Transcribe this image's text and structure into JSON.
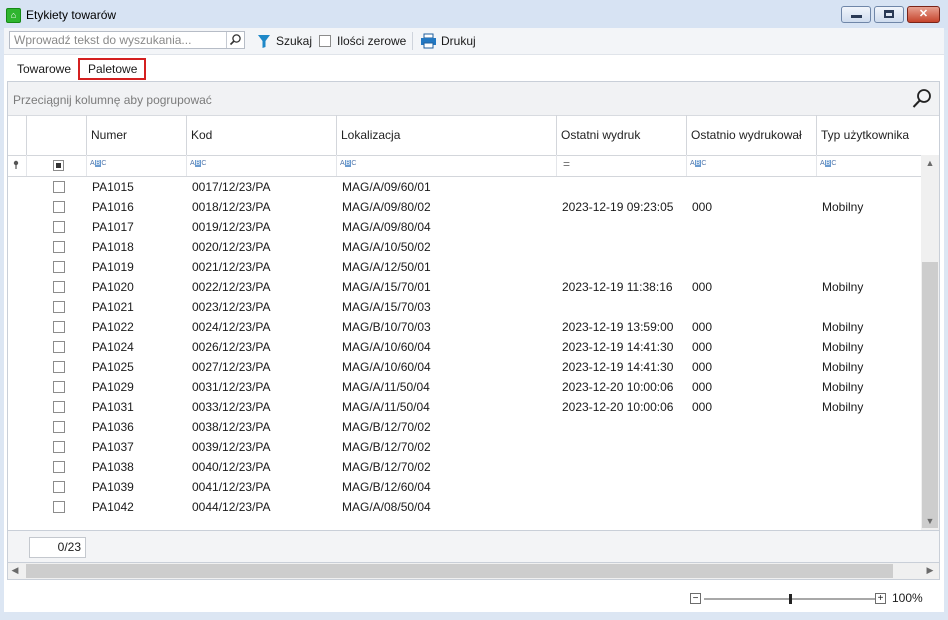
{
  "window": {
    "title": "Etykiety towarów",
    "close_symbol": "✕"
  },
  "toolbar": {
    "search_placeholder": "Wprowadź tekst do wyszukania...",
    "search_button": "Szukaj",
    "zero_qty_label": "Ilości zerowe",
    "print_label": "Drukuj"
  },
  "tabs": [
    {
      "label": "Towarowe"
    },
    {
      "label": "Paletowe"
    }
  ],
  "grid": {
    "group_hint": "Przeciągnij kolumnę aby pogrupować",
    "columns": [
      "Numer",
      "Kod",
      "Lokalizacja",
      "Ostatni wydruk",
      "Ostatnio wydrukował",
      "Typ użytkownika"
    ],
    "rows": [
      [
        "PA1015",
        "0017/12/23/PA",
        "MAG/A/09/60/01",
        "",
        "",
        ""
      ],
      [
        "PA1016",
        "0018/12/23/PA",
        "MAG/A/09/80/02",
        "2023-12-19 09:23:05",
        "000",
        "Mobilny"
      ],
      [
        "PA1017",
        "0019/12/23/PA",
        "MAG/A/09/80/04",
        "",
        "",
        ""
      ],
      [
        "PA1018",
        "0020/12/23/PA",
        "MAG/A/10/50/02",
        "",
        "",
        ""
      ],
      [
        "PA1019",
        "0021/12/23/PA",
        "MAG/A/12/50/01",
        "",
        "",
        ""
      ],
      [
        "PA1020",
        "0022/12/23/PA",
        "MAG/A/15/70/01",
        "2023-12-19 11:38:16",
        "000",
        "Mobilny"
      ],
      [
        "PA1021",
        "0023/12/23/PA",
        "MAG/A/15/70/03",
        "",
        "",
        ""
      ],
      [
        "PA1022",
        "0024/12/23/PA",
        "MAG/B/10/70/03",
        "2023-12-19 13:59:00",
        "000",
        "Mobilny"
      ],
      [
        "PA1024",
        "0026/12/23/PA",
        "MAG/A/10/60/04",
        "2023-12-19 14:41:30",
        "000",
        "Mobilny"
      ],
      [
        "PA1025",
        "0027/12/23/PA",
        "MAG/A/10/60/04",
        "2023-12-19 14:41:30",
        "000",
        "Mobilny"
      ],
      [
        "PA1029",
        "0031/12/23/PA",
        "MAG/A/11/50/04",
        "2023-12-20 10:00:06",
        "000",
        "Mobilny"
      ],
      [
        "PA1031",
        "0033/12/23/PA",
        "MAG/A/11/50/04",
        "2023-12-20 10:00:06",
        "000",
        "Mobilny"
      ],
      [
        "PA1036",
        "0038/12/23/PA",
        "MAG/B/12/70/02",
        "",
        "",
        ""
      ],
      [
        "PA1037",
        "0039/12/23/PA",
        "MAG/B/12/70/02",
        "",
        "",
        ""
      ],
      [
        "PA1038",
        "0040/12/23/PA",
        "MAG/B/12/70/02",
        "",
        "",
        ""
      ],
      [
        "PA1039",
        "0041/12/23/PA",
        "MAG/B/12/60/04",
        "",
        "",
        ""
      ],
      [
        "PA1042",
        "0044/12/23/PA",
        "MAG/A/08/50/04",
        "",
        "",
        ""
      ]
    ],
    "filter_abc": "ABC",
    "filter_equals": "=",
    "selected_count": "0/23"
  },
  "zoom": {
    "value": "100%",
    "minus": "−",
    "plus": "+"
  },
  "colors": {
    "accent_tab_border": "#d42020",
    "title_bg": "#d7e3f3"
  },
  "icons": [
    "app-icon",
    "search-icon",
    "filter-icon",
    "printer-icon",
    "pin-icon",
    "magnifier-icon",
    "scroll-up-icon",
    "scroll-down-icon",
    "scroll-left-icon",
    "scroll-right-icon"
  ]
}
